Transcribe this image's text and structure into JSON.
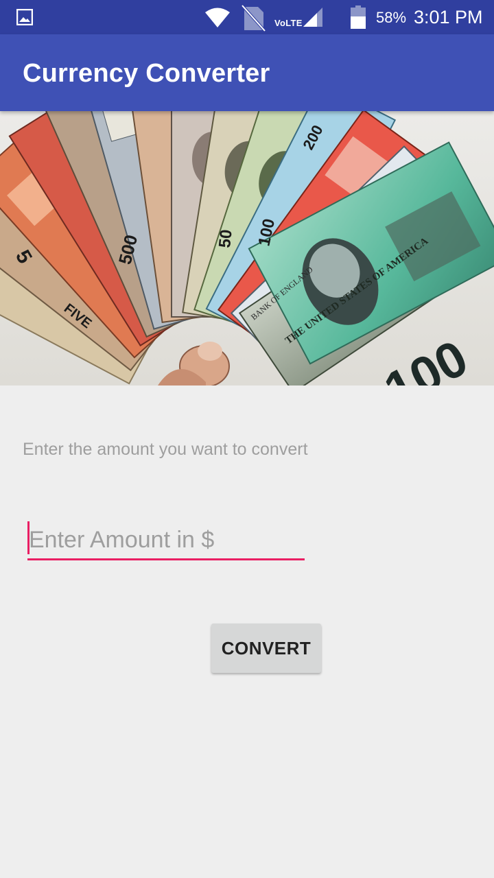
{
  "status_bar": {
    "icons": [
      "gallery-icon",
      "wifi-icon",
      "no-sim-icon",
      "signal-icon",
      "battery-icon"
    ],
    "volte": "VoLTE",
    "battery_percent": "58%",
    "time": "3:01 PM"
  },
  "app_bar": {
    "title": "Currency Converter",
    "color": "#3f51b5",
    "status_color": "#303f9f"
  },
  "banner": {
    "note_labels": [
      "100",
      "500",
      "50",
      "100",
      "200",
      "5",
      "FIVE",
      "THE UNITED STATES OF AMERICA",
      "BANK OF ENGLAND"
    ]
  },
  "form": {
    "label": "Enter the amount you want to convert",
    "amount": {
      "value": "",
      "placeholder": "Enter Amount in $"
    },
    "accent_color": "#e91e63",
    "convert_label": "CONVERT"
  }
}
